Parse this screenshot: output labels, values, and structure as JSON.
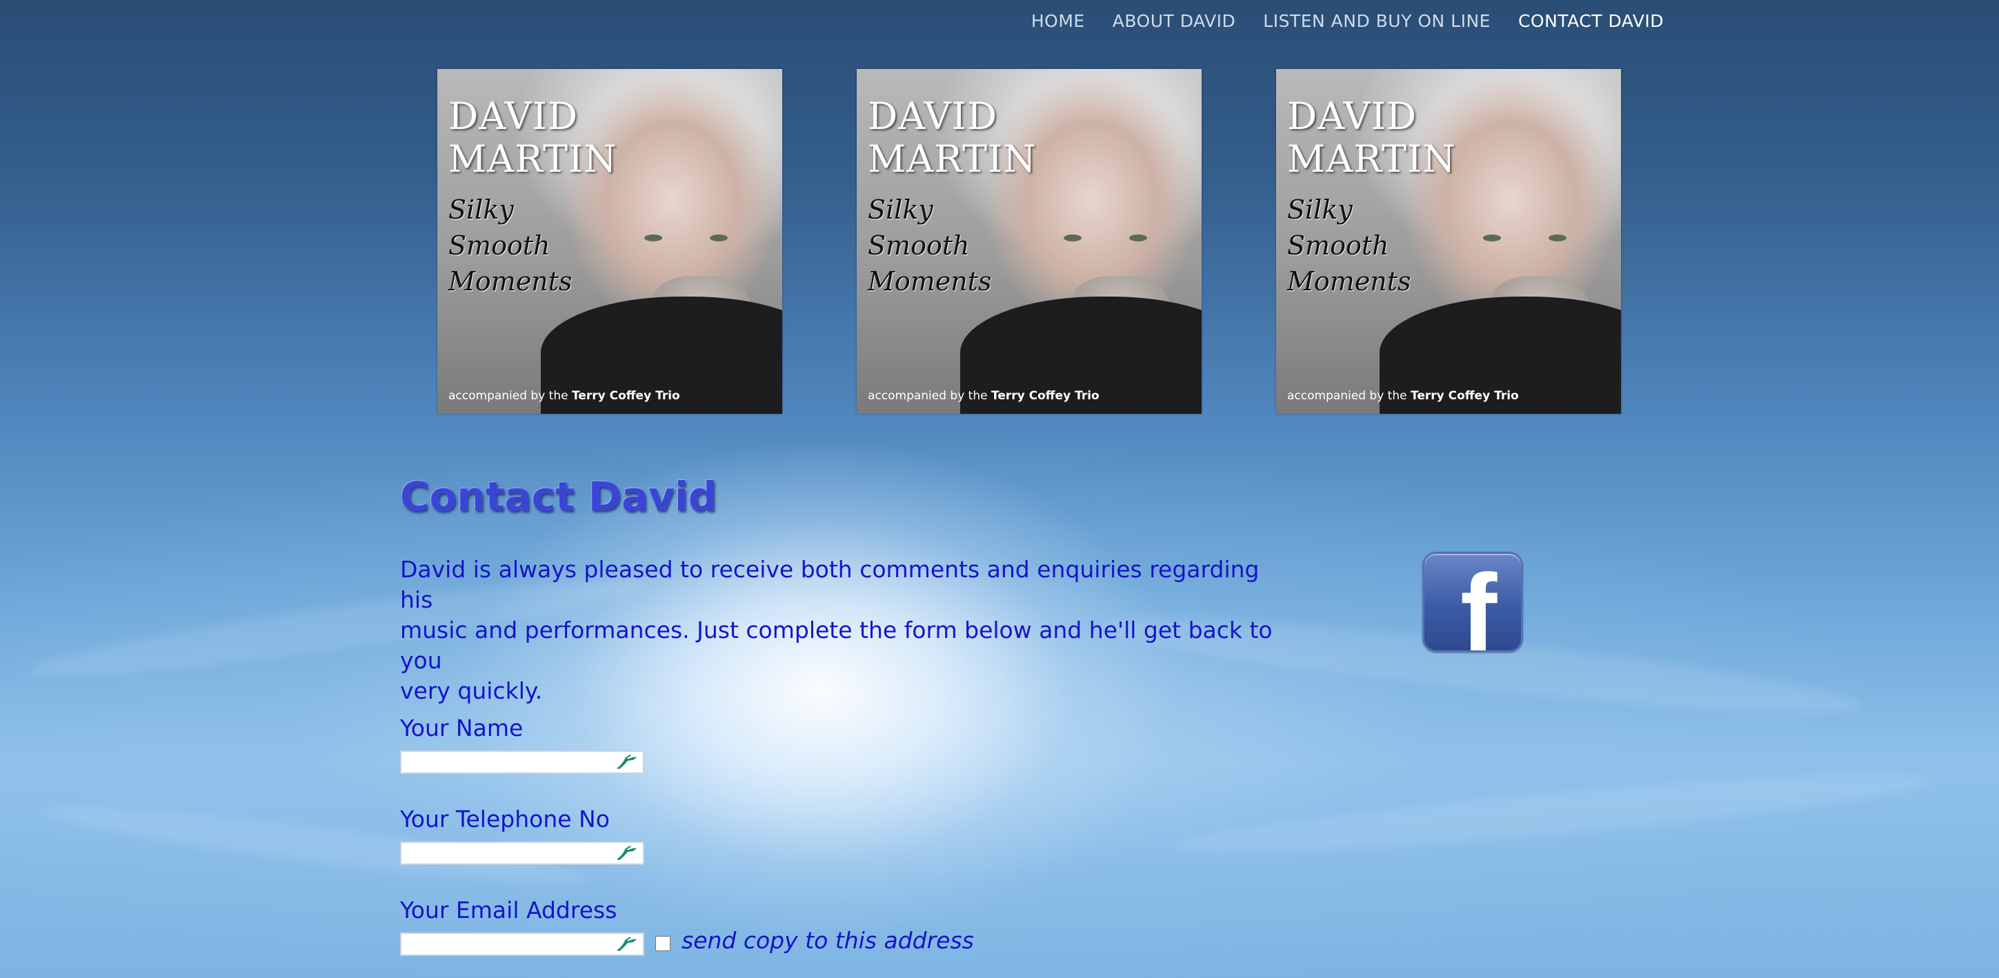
{
  "nav": {
    "items": [
      {
        "label": "HOME"
      },
      {
        "label": "ABOUT DAVID"
      },
      {
        "label": "LISTEN AND BUY ON LINE"
      },
      {
        "label": "CONTACT DAVID"
      }
    ],
    "active": "CONTACT DAVID"
  },
  "covers": [
    {
      "title_line1": "DAVID",
      "title_line2": "MARTIN",
      "subtitle_line1": "Silky",
      "subtitle_line2": "Smooth",
      "subtitle_line3": "Moments",
      "credit_prefix": "accompanied by  the",
      "credit_name": "Terry Coffey Trio"
    },
    {
      "title_line1": "DAVID",
      "title_line2": "MARTIN",
      "subtitle_line1": "Silky",
      "subtitle_line2": "Smooth",
      "subtitle_line3": "Moments",
      "credit_prefix": "accompanied by  the",
      "credit_name": "Terry Coffey Trio"
    },
    {
      "title_line1": "DAVID",
      "title_line2": "MARTIN",
      "subtitle_line1": "Silky",
      "subtitle_line2": "Smooth",
      "subtitle_line3": "Moments",
      "credit_prefix": "accompanied by  the",
      "credit_name": "Terry Coffey Trio"
    }
  ],
  "contact": {
    "title": "Contact David",
    "intro": "David is always pleased to receive both comments and enquiries regarding his\nmusic and performances.  Just complete the form below and he'll get back to you\nvery quickly."
  },
  "social": {
    "icon": "facebook-icon",
    "glyph": "f"
  },
  "form": {
    "name_label": "Your Name",
    "name_value": "",
    "phone_label": "Your Telephone No",
    "phone_value": "",
    "email_label": "Your Email Address",
    "email_value": "",
    "copy_label": "send copy to this address",
    "copy_checked": false
  },
  "colors": {
    "text_blue": "#1414c8",
    "title_blue": "#3a45d6",
    "facebook_blue": "#3b5ba5"
  }
}
